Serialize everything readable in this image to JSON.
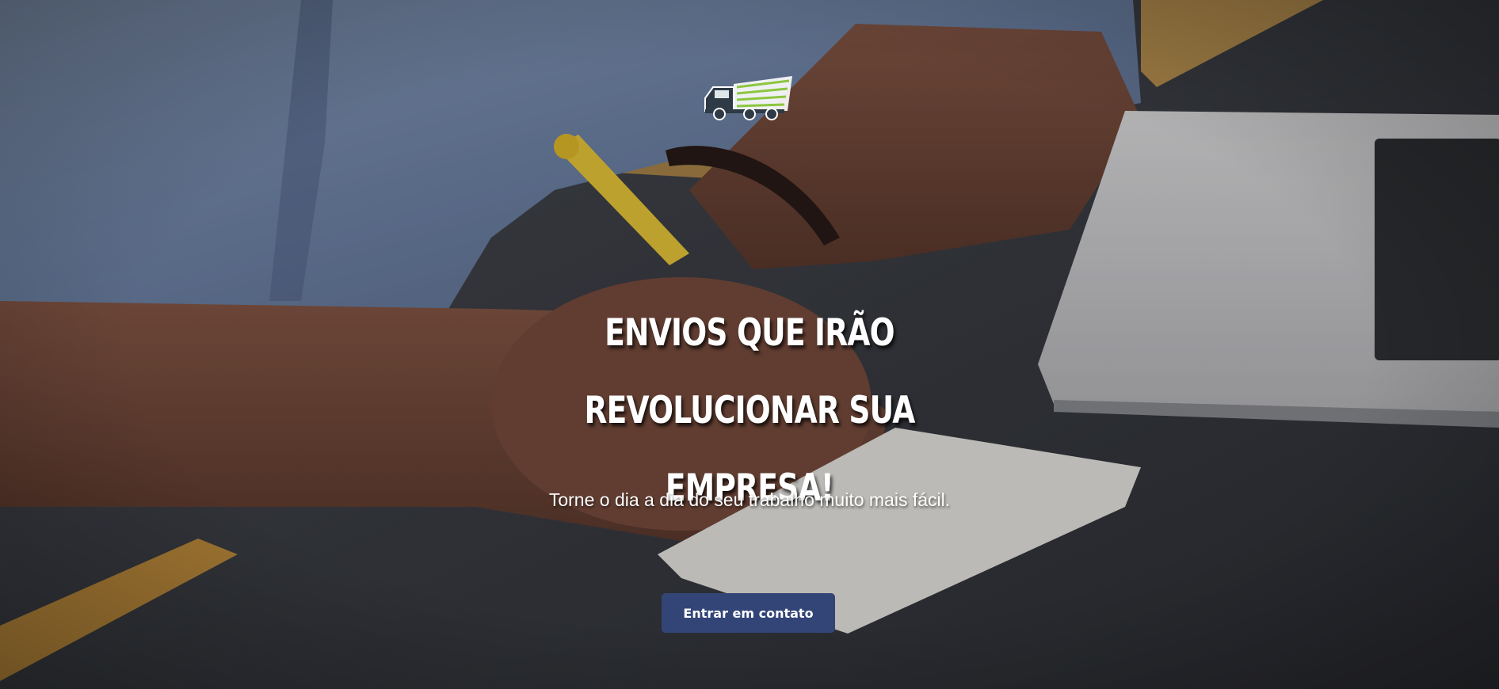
{
  "hero": {
    "logo_icon": "delivery-truck-icon",
    "headline_line1": "ENVIOS QUE IRÃO REVOLUCIONAR SUA",
    "headline_line2": "EMPRESA!",
    "subtitle": "Torne o dia a dia do seu trabalho muito mais fácil.",
    "cta_label": "Entrar em contato"
  },
  "colors": {
    "cta_background": "#334577",
    "text": "#ffffff",
    "logo_speed_lines": "#8cc63f",
    "logo_truck": "#2e3a45"
  }
}
